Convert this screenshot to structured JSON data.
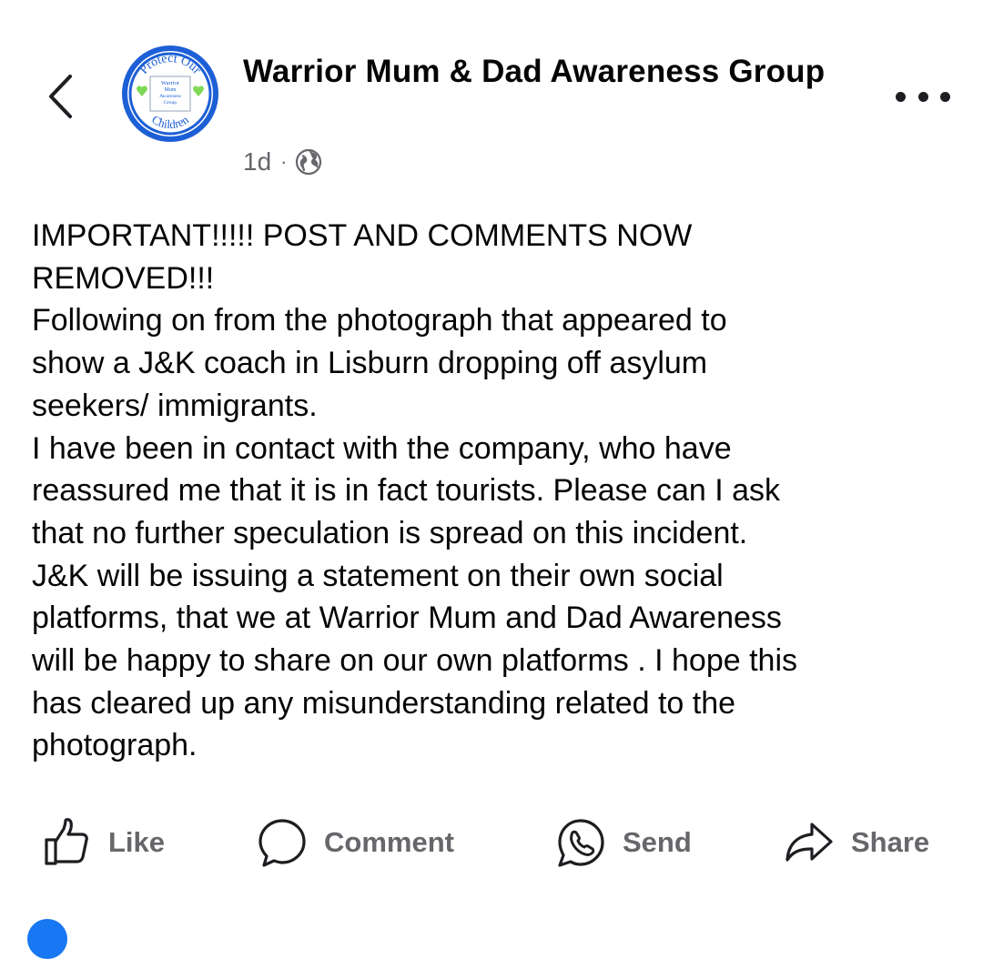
{
  "header": {
    "back_icon": "chevron-left-icon",
    "author_name": "Warrior Mum & Dad Awareness Group",
    "timestamp": "1d",
    "separator": "·",
    "privacy_icon": "globe-icon",
    "more_icon": "more-horizontal-icon"
  },
  "avatar": {
    "ring_text_top": "Protect Our",
    "ring_text_bottom": "Children",
    "center_line_1": "Warrior",
    "center_line_2": "Mum",
    "center_line_3": "Awareness",
    "center_line_4": "Group",
    "colors": {
      "ring": "#1d5fd6",
      "hearts": "#7ed957"
    }
  },
  "post": {
    "lines": [
      "IMPORTANT!!!!! POST AND COMMENTS NOW",
      "REMOVED!!!",
      "Following on from the photograph that appeared to",
      "show a J&K coach in Lisburn dropping off asylum",
      "seekers/ immigrants.",
      "I have been in contact with the company, who have",
      "reassured me that it is in fact tourists. Please can I ask",
      "that no further speculation is spread on this incident.",
      "J&K will be issuing a statement on their own social",
      "platforms,  that we at Warrior Mum and Dad Awareness",
      "will be happy to share on our own platforms . I hope this",
      "has cleared up any misunderstanding related to the",
      "photograph."
    ]
  },
  "actions": {
    "like": {
      "label": "Like",
      "icon": "thumbs-up-icon"
    },
    "comment": {
      "label": "Comment",
      "icon": "comment-icon"
    },
    "send": {
      "label": "Send",
      "icon": "whatsapp-icon"
    },
    "share": {
      "label": "Share",
      "icon": "share-icon"
    }
  },
  "colors": {
    "text": "#050505",
    "secondary": "#65676b",
    "accent": "#1877f2"
  }
}
